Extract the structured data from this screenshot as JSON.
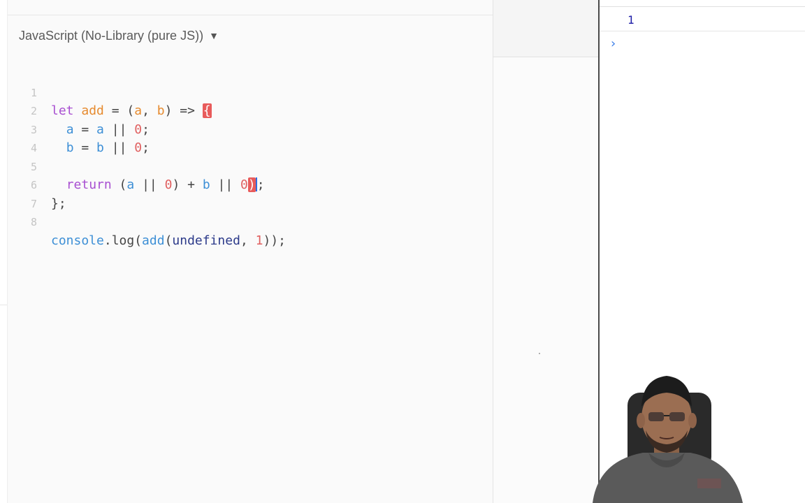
{
  "editor": {
    "language_label": "JavaScript (No-Library (pure JS))",
    "language_caret": "▼",
    "lines": [
      {
        "num": "1"
      },
      {
        "num": "2"
      },
      {
        "num": "3"
      },
      {
        "num": "4"
      },
      {
        "num": "5"
      },
      {
        "num": "6"
      },
      {
        "num": "7"
      },
      {
        "num": "8"
      }
    ],
    "tokens": {
      "l1_let": "let",
      "l1_add": "add",
      "l1_eq": " = (",
      "l1_a": "a",
      "l1_comma": ", ",
      "l1_b": "b",
      "l1_arrow": ") => ",
      "l1_brace": "{",
      "l2_a1": "a",
      "l2_mid": " = ",
      "l2_a2": "a",
      "l2_or": " || ",
      "l2_zero": "0",
      "l2_semi": ";",
      "l3_b1": "b",
      "l3_mid": " = ",
      "l3_b2": "b",
      "l3_or": " || ",
      "l3_zero": "0",
      "l3_semi": ";",
      "l5_return": "return",
      "l5_open": " (",
      "l5_a": "a",
      "l5_or1": " || ",
      "l5_zero1": "0",
      "l5_close_plus": ") + ",
      "l5_b": "b",
      "l5_or2": " || ",
      "l5_zero2": "0",
      "l5_paren": ")",
      "l5_semi": ";",
      "l6_close": "};",
      "l8_console": "console",
      "l8_log": ".log(",
      "l8_add": "add",
      "l8_open": "(",
      "l8_undefined": "undefined",
      "l8_comma": ", ",
      "l8_one": "1",
      "l8_end": "));"
    }
  },
  "console": {
    "output_value": "1",
    "prompt_symbol": "›"
  },
  "colors": {
    "keyword": "#a84fd1",
    "function_name": "#e68a2e",
    "variable": "#3d8fd6",
    "number": "#e06060",
    "match_highlight": "#e85b5b",
    "console_output": "#1a1aa6"
  }
}
